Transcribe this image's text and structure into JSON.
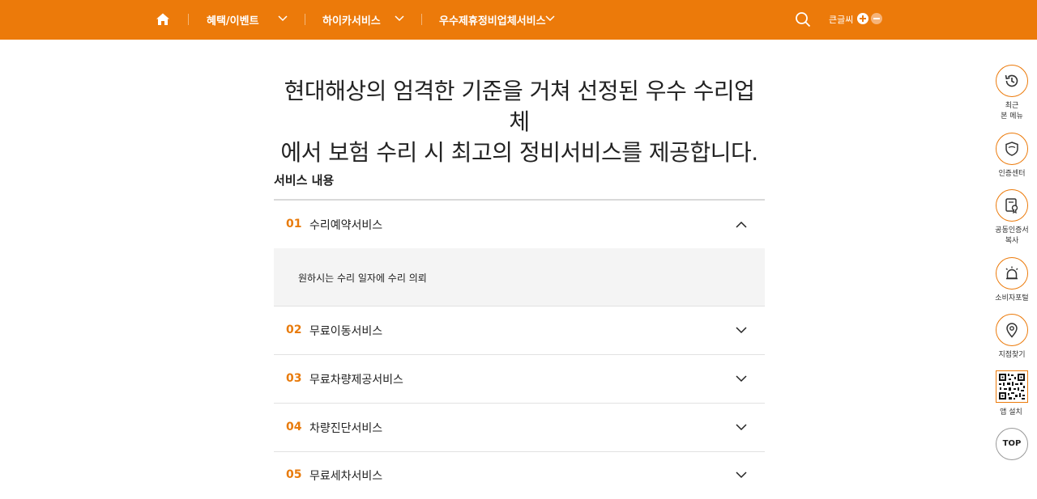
{
  "colors": {
    "brand": "#ec7a0a",
    "accent_number": "#e87b0c"
  },
  "header": {
    "home_icon": "home-icon",
    "nav": [
      {
        "label": "혜택/이벤트"
      },
      {
        "label": "하이카서비스"
      },
      {
        "label": "우수제휴정비업체서비스"
      }
    ],
    "search_icon": "search-icon",
    "font_size_label": "큰글씨"
  },
  "main": {
    "headline_line1": "현대해상의 엄격한 기준을 거쳐 선정된 우수 수리업체",
    "headline_line2": "에서 보험 수리 시 최고의 정비서비스를 제공합니다.",
    "section_title": "서비스 내용",
    "services": [
      {
        "num": "01",
        "title": "수리예약서비스",
        "expanded": true,
        "detail": "원하시는 수리 일자에 수리 의뢰"
      },
      {
        "num": "02",
        "title": "무료이동서비스",
        "expanded": false
      },
      {
        "num": "03",
        "title": "무료차량제공서비스",
        "expanded": false
      },
      {
        "num": "04",
        "title": "차량진단서비스",
        "expanded": false
      },
      {
        "num": "05",
        "title": "무료세차서비스",
        "expanded": false
      }
    ]
  },
  "quick_menu": {
    "items": [
      {
        "label": "최근\n본 메뉴",
        "icon": "history-icon"
      },
      {
        "label": "인증센터",
        "icon": "shield-icon"
      },
      {
        "label": "공동인증서\n복사",
        "icon": "certificate-icon"
      },
      {
        "label": "소비자포털",
        "icon": "alarm-bell-icon"
      },
      {
        "label": "지점찾기",
        "icon": "location-pin-icon"
      },
      {
        "label": "앱 설치",
        "icon": "qr-code-icon"
      }
    ],
    "top_label": "TOP"
  }
}
